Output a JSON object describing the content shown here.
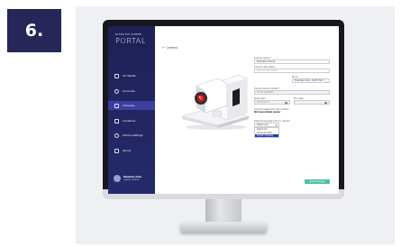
{
  "step_badge": "6.",
  "app": {
    "brand_small": "NYSEN EYE SCREEN",
    "brand_big": "PORTAL"
  },
  "sidebar": {
    "items": [
      {
        "label": "All results"
      },
      {
        "label": "Accounts"
      },
      {
        "label": "Cameras"
      },
      {
        "label": "Locations"
      },
      {
        "label": "Admin settings"
      },
      {
        "label": "About"
      }
    ],
    "active_index": 2,
    "user": {
      "name": "Melanie Cole",
      "role": "Super admin"
    }
  },
  "main": {
    "back_label": "Camera",
    "form": {
      "camera_name_label": "Camera name *",
      "camera_name_value": "Example camera",
      "camera_description_label": "Camera description",
      "camera_description_value": "Camera description",
      "store_label": "Store",
      "store_value": "Example Clinic, 5025-39-1?",
      "camera_serial_label": "Camera serial number *",
      "camera_serial_value": "C23-B-DS46BF8",
      "start_date_label": "Start date *",
      "start_date_value": "2022-06-13",
      "end_date_label": "End date",
      "end_date_value": "",
      "camera_supplier_label": "Camera assigned to the location",
      "camera_supplier_value": "Not associated owner",
      "default_language_label": "Default language of UI in camera",
      "language_selected": "Select one",
      "language_options": [
        "Select one",
        "Suomi (Finnish)",
        "English (English)"
      ],
      "language_highlighted_index": 2,
      "save_label": "Save changes"
    }
  },
  "colors": {
    "sidebar": "#1d2156",
    "badge": "#242757",
    "accent_button": "#4fc0a8",
    "selection": "#2b3aa6"
  }
}
